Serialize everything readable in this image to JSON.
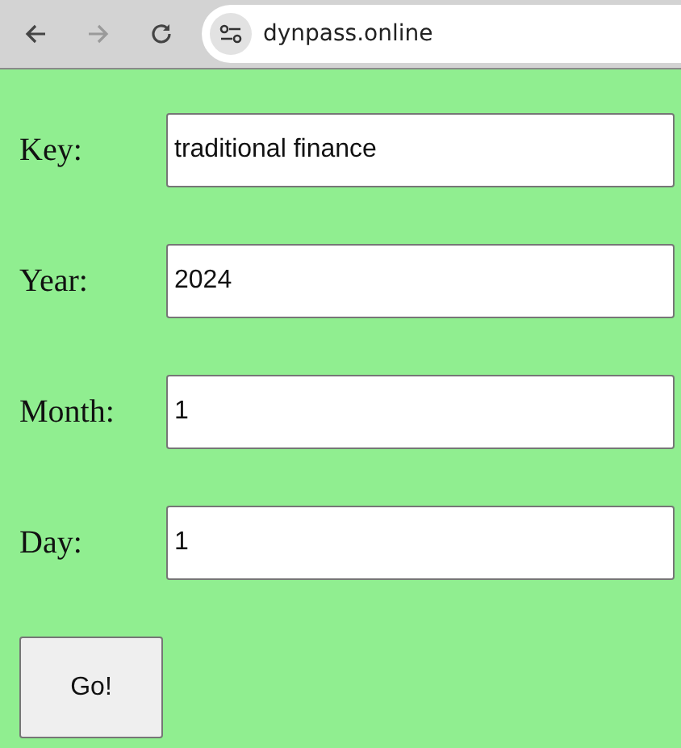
{
  "browser": {
    "url": "dynpass.online"
  },
  "fields": [
    {
      "label": "Key:",
      "value": "traditional finance"
    },
    {
      "label": "Year:",
      "value": "2024"
    },
    {
      "label": "Month:",
      "value": "1"
    },
    {
      "label": "Day:",
      "value": "1"
    }
  ],
  "submit_button": "Go!"
}
